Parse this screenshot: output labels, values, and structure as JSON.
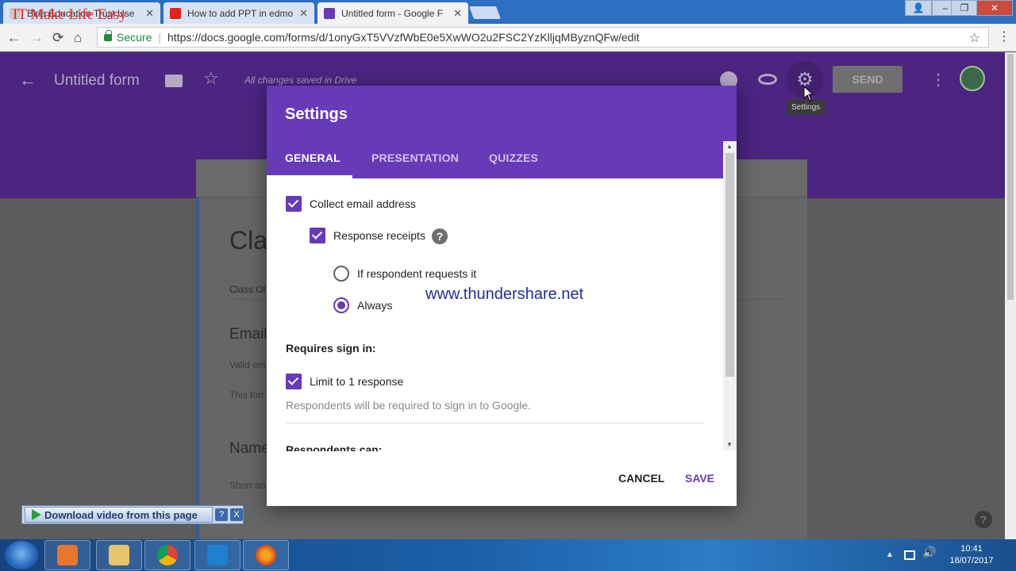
{
  "browser": {
    "overlay_brand": "IT Make Life Easy",
    "tabs": [
      {
        "title": "Birla Education Trust Use",
        "close": "✕"
      },
      {
        "title": "How to add PPT in edmo",
        "close": "✕"
      },
      {
        "title": "Untitled form - Google F",
        "close": "✕"
      }
    ],
    "window_controls": {
      "minimize": "–",
      "restore": "❐",
      "close": "✕",
      "profile": "👤"
    },
    "nav": {
      "back": "←",
      "forward": "→",
      "reload": "⟳",
      "home": "⌂"
    },
    "address": {
      "secure_label": "Secure",
      "url": "https://docs.google.com/forms/d/1onyGxT5VVzfWbE0e5XwWO2u2FSC2YzKlljqMByznQFw/edit",
      "bookmark": "☆"
    },
    "menu": "⋮"
  },
  "forms_header": {
    "back": "←",
    "title": "Untitled form",
    "star": "☆",
    "saved_status": "All changes saved in Drive",
    "gear": "⚙",
    "settings_tooltip": "Settings",
    "send_label": "SEND",
    "more": "⋮"
  },
  "form_background": {
    "title_partial": "Cla",
    "desc_partial": "Class Ol",
    "q1_title": "Email",
    "q1_hint": "Valid em",
    "q1_note": "This forr",
    "q2_title": "Name",
    "q2_hint": "Short an",
    "help": "?"
  },
  "settings_dialog": {
    "title": "Settings",
    "tabs": [
      "GENERAL",
      "PRESENTATION",
      "QUIZZES"
    ],
    "active_tab": "GENERAL",
    "collect_email_label": "Collect email address",
    "collect_email_checked": true,
    "response_receipts_label": "Response receipts",
    "response_receipts_checked": true,
    "help": "?",
    "receipt_options": [
      "If respondent requests it",
      "Always"
    ],
    "receipt_selected": "Always",
    "requires_signin_heading": "Requires sign in:",
    "limit_label": "Limit to 1 response",
    "limit_checked": true,
    "limit_hint": "Respondents will be required to sign in to Google.",
    "respondents_can_heading": "Respondents can:",
    "cancel_label": "CANCEL",
    "save_label": "SAVE",
    "scroll_up": "▲",
    "scroll_down": "▼"
  },
  "watermark": "www.thundershare.net",
  "download_bar": {
    "label": "Download video from this page",
    "help": "?",
    "close": "X"
  },
  "taskbar": {
    "tray_arrow": "▲",
    "time": "10:41",
    "date": "18/07/2017"
  },
  "colors": {
    "forms_purple": "#673ab7",
    "dimmed_header": "#4b2580",
    "secure_green": "#1e8a3a",
    "watermark_blue": "#1f2fa0"
  }
}
